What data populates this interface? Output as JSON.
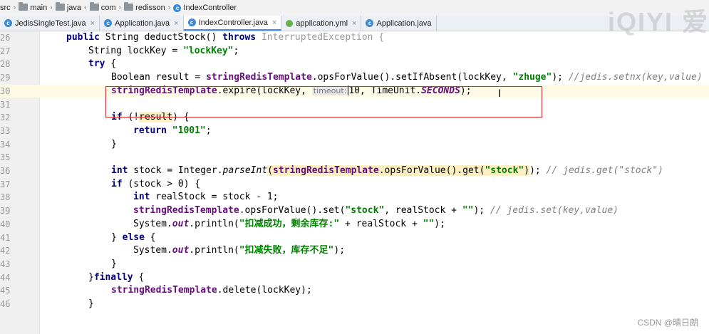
{
  "breadcrumb": {
    "items": [
      "src",
      "main",
      "java",
      "com",
      "redisson",
      "IndexController"
    ]
  },
  "tabs": [
    {
      "label": "JedisSingleTest.java",
      "icon": "class-icon"
    },
    {
      "label": "Application.java",
      "icon": "class-icon"
    },
    {
      "label": "IndexController.java",
      "icon": "class-icon",
      "active": true
    },
    {
      "label": "application.yml",
      "icon": "yml-icon"
    },
    {
      "label": "Application.java",
      "icon": "class-icon"
    }
  ],
  "close_glyph": "×",
  "editor": {
    "line_numbers": [
      "26",
      "27",
      "28",
      "29",
      "30",
      "31",
      "32",
      "33",
      "34",
      "35",
      "36",
      "37",
      "38",
      "39",
      "40",
      "41",
      "42",
      "43",
      "44",
      "45",
      "46"
    ],
    "current_line": "30",
    "param_hint": "timeout:",
    "tokens": {
      "l26_public": "public",
      "l26_sig": " String deductStock() ",
      "l26_throws": "throws",
      "l26_exc": " InterruptedException {",
      "l27_decl": "String lockKey = ",
      "l27_val": "\"lockKey\"",
      "l27_end": ";",
      "l28_try": "try",
      "l28_brace": " {",
      "l29_decl": "Boolean result = ",
      "l29_field": "stringRedisTemplate",
      "l29_call": ".opsForValue().setIfAbsent(lockKey, ",
      "l29_val": "\"zhuge\"",
      "l29_end": "); ",
      "l29_comment": "//jedis.setnx(key,value)",
      "l30_field": "stringRedisTemplate",
      "l30_call": ".expire(lockKey, ",
      "l30_num": "10, TimeUnit.",
      "l30_const": "SECONDS",
      "l30_end": ");",
      "l32_if": "if",
      "l32_paren": " (!",
      "l32_var": "result",
      "l32_end": ") {",
      "l33_return": "return",
      "l33_sp": " ",
      "l33_val": "\"1001\"",
      "l33_end": ";",
      "l34_brace": "}",
      "l36_int": "int",
      "l36_decl": " stock = Integer.",
      "l36_parse": "parseInt",
      "l36_paren": "(",
      "l36_arg_field": "stringRedisTemplate",
      "l36_arg_call": ".opsForValue().get(",
      "l36_arg_val": "\"stock\"",
      "l36_arg_end": ")",
      "l36_end": "); ",
      "l36_comment": "// jedis.get(\"stock\")",
      "l37_if": "if",
      "l37_cond": " (stock > 0) {",
      "l38_int": "int",
      "l38_decl": " realStock = stock - 1;",
      "l39_field": "stringRedisTemplate",
      "l39_call": ".opsForValue().set(",
      "l39_val1": "\"stock\"",
      "l39_mid": ", realStock + ",
      "l39_val2": "\"\"",
      "l39_end": "); ",
      "l39_comment": "// jedis.set(key,value)",
      "l40_sys": "System.",
      "l40_out": "out",
      "l40_call": ".println(",
      "l40_val1": "\"扣减成功，剩余库存:\"",
      "l40_mid": " + realStock + ",
      "l40_val2": "\"\"",
      "l40_end": ");",
      "l41_brace": "} ",
      "l41_else": "else",
      "l41_end": " {",
      "l42_sys": "System.",
      "l42_out": "out",
      "l42_call": ".println(",
      "l42_val": "\"扣减失败，库存不足\"",
      "l42_end": ");",
      "l43_brace": "}",
      "l44_brace": "}",
      "l44_finally": "finally",
      "l44_end": " {",
      "l45_field": "stringRedisTemplate",
      "l45_call": ".delete(lockKey);",
      "l46_brace": "}"
    }
  },
  "watermark": "iQIYI 爱",
  "csdn_credit": "CSDN @晴日朗"
}
